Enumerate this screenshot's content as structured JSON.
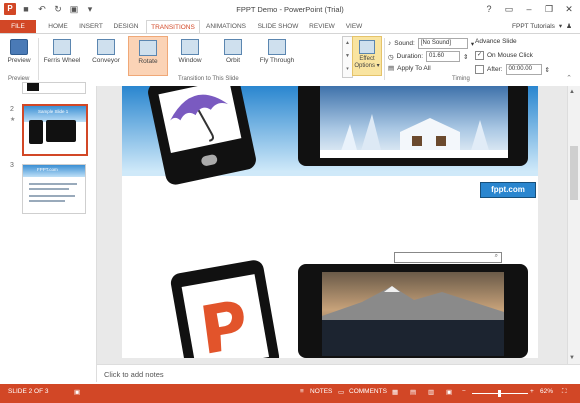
{
  "window": {
    "title": "FPPT Demo - PowerPoint (Trial)"
  },
  "tabs": [
    "FILE",
    "HOME",
    "INSERT",
    "DESIGN",
    "TRANSITIONS",
    "ANIMATIONS",
    "SLIDE SHOW",
    "REVIEW",
    "VIEW"
  ],
  "account": {
    "name": "FPPT Tutorials"
  },
  "ribbon": {
    "preview": "Preview",
    "transitions": [
      "Ferris Wheel",
      "Conveyor",
      "Rotate",
      "Window",
      "Orbit",
      "Fly Through"
    ],
    "effect_options": [
      "Effect",
      "Options"
    ],
    "group_labels": {
      "preview": "Preview",
      "transition": "Transition to This Slide",
      "timing": "Timing"
    },
    "sound_label": "Sound:",
    "sound_value": "[No Sound]",
    "duration_label": "Duration:",
    "duration_value": "01.60",
    "apply_all": "Apply To All",
    "advance_label": "Advance Slide",
    "on_click": "On Mouse Click",
    "after_label": "After:",
    "after_value": "00:00.00"
  },
  "thumbs": {
    "numbers": [
      "2",
      "3"
    ],
    "slide3_title": "FPPT.com",
    "slide2_title": "Sample Slide 1"
  },
  "slide": {
    "logo": "fppt.com"
  },
  "notes": {
    "placeholder": "Click to add notes"
  },
  "status": {
    "slide": "SLIDE 2 OF 3",
    "notes": "NOTES",
    "comments": "COMMENTS",
    "zoom": "62%"
  },
  "colors": {
    "accent": "#d24726"
  }
}
